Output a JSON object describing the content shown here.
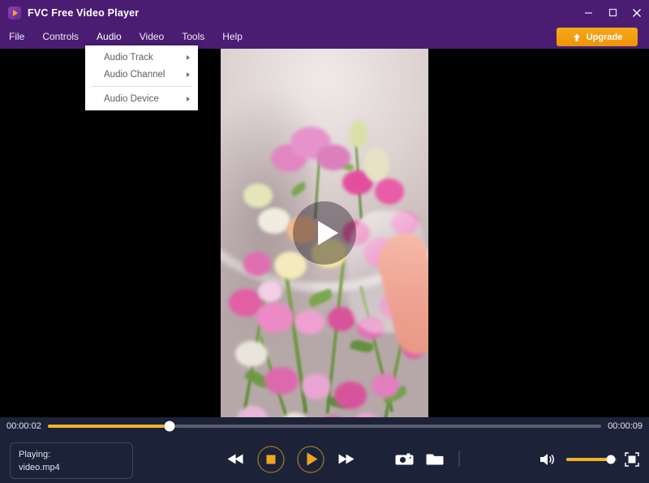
{
  "window": {
    "title": "FVC Free Video Player",
    "app_icon": "play-logo-icon",
    "minimize": "minimize-icon",
    "maximize": "maximize-icon",
    "close": "close-icon"
  },
  "menubar": {
    "items": [
      {
        "label": "File"
      },
      {
        "label": "Controls"
      },
      {
        "label": "Audio"
      },
      {
        "label": "Video"
      },
      {
        "label": "Tools"
      },
      {
        "label": "Help"
      }
    ],
    "active_index": 2,
    "upgrade": {
      "label": "Upgrade",
      "icon": "upload-arrow-icon",
      "color": "#f5a51a"
    }
  },
  "dropdown": {
    "open_for": "Audio",
    "items": [
      {
        "label": "Audio Track",
        "submenu": true
      },
      {
        "label": "Audio Channel",
        "submenu": true
      },
      {
        "label": "Audio Device",
        "submenu": true
      }
    ]
  },
  "player": {
    "overlay_icon": "play-overlay-icon",
    "current_time": "00:00:02",
    "total_time": "00:00:09",
    "progress_percent": 22,
    "volume_percent": 88,
    "status_label": "Playing:",
    "file_name": "video.mp4"
  },
  "controls": {
    "rewind": "rewind-icon",
    "stop": "stop-icon",
    "play": "play-icon",
    "forward": "fast-forward-icon",
    "snapshot": "camera-icon",
    "open_folder": "folder-icon",
    "volume": "volume-icon",
    "fullscreen": "fullscreen-icon"
  },
  "colors": {
    "titlebar": "#4a1d73",
    "accent_orange": "#f0b428",
    "panel": "#1c2339"
  }
}
